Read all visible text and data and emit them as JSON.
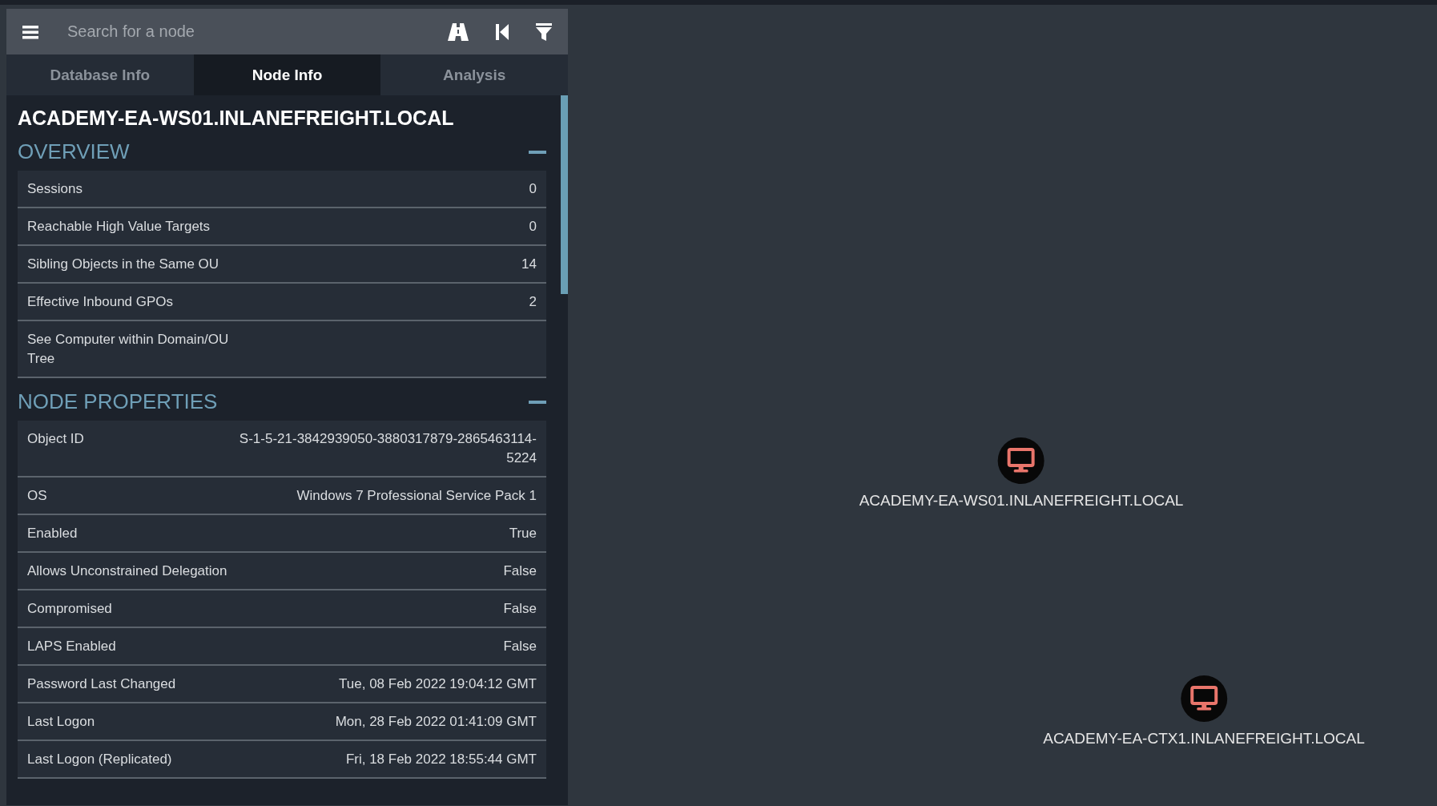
{
  "search": {
    "placeholder": "Search for a node"
  },
  "tabs": [
    {
      "label": "Database Info",
      "selected": false
    },
    {
      "label": "Node Info",
      "selected": true
    },
    {
      "label": "Analysis",
      "selected": false
    }
  ],
  "node_title": "ACADEMY-EA-WS01.INLANEFREIGHT.LOCAL",
  "sections": [
    {
      "title": "OVERVIEW",
      "expanded": true,
      "rows": [
        {
          "label": "Sessions",
          "value": "0"
        },
        {
          "label": "Reachable High Value Targets",
          "value": "0"
        },
        {
          "label": "Sibling Objects in the Same OU",
          "value": "14"
        },
        {
          "label": "Effective Inbound GPOs",
          "value": "2"
        },
        {
          "label": "See Computer within Domain/OU Tree"
        }
      ]
    },
    {
      "title": "NODE PROPERTIES",
      "expanded": true,
      "rows": [
        {
          "label": "Object ID",
          "value": "S-1-5-21-3842939050-3880317879-2865463114-5224"
        },
        {
          "label": "OS",
          "value": "Windows 7 Professional Service Pack 1"
        },
        {
          "label": "Enabled",
          "value": "True"
        },
        {
          "label": "Allows Unconstrained Delegation",
          "value": "False"
        },
        {
          "label": "Compromised",
          "value": "False"
        },
        {
          "label": "LAPS Enabled",
          "value": "False"
        },
        {
          "label": "Password Last Changed",
          "value": "Tue, 08 Feb 2022 19:04:12 GMT"
        },
        {
          "label": "Last Logon",
          "value": "Mon, 28 Feb 2022 01:41:09 GMT"
        },
        {
          "label": "Last Logon (Replicated)",
          "value": "Fri, 18 Feb 2022 18:55:44 GMT"
        }
      ]
    }
  ],
  "graph": {
    "nodes": [
      {
        "label": "ACADEMY-EA-WS01.INLANEFREIGHT.LOCAL"
      },
      {
        "label": "ACADEMY-EA-CTX1.INLANEFREIGHT.LOCAL"
      }
    ]
  }
}
